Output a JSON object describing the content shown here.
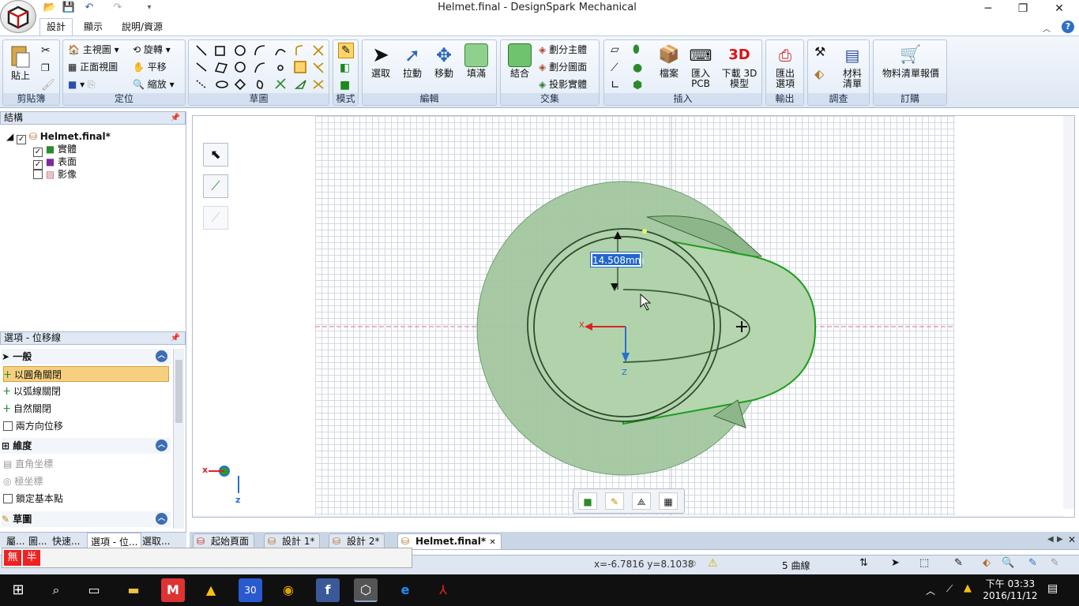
{
  "window": {
    "title": "Helmet.final - DesignSpark Mechanical",
    "minimize": "─",
    "maximize": "❐",
    "close": "✕"
  },
  "quick_access": {
    "open_icon": "folder-open",
    "save_icon": "save",
    "undo_icon": "undo",
    "redo_icon": "redo"
  },
  "ribbon_tabs": [
    "設計",
    "顯示",
    "說明/資源"
  ],
  "ribbon_tab_help": "?",
  "groups": {
    "clipboard": {
      "label": "剪貼簿",
      "paste": "貼上"
    },
    "orient": {
      "label": "定位",
      "home": "主視圖",
      "rotate": "旋轉",
      "front": "正面視圖",
      "pan": "平移",
      "zoom": "縮放"
    },
    "sketch": {
      "label": "草圖"
    },
    "mode": {
      "label": "模式"
    },
    "edit": {
      "label": "編輯",
      "select": "選取",
      "pull": "拉動",
      "move": "移動",
      "fill": "填滿"
    },
    "intersect": {
      "label": "交集",
      "combine": "結合",
      "split_body": "劃分主體",
      "split_face": "劃分圖面",
      "project": "投影實體"
    },
    "insert": {
      "label": "插入",
      "file": "檔案",
      "import_pcb": "匯入\nPCB",
      "download_3d": "下載 3D\n模型"
    },
    "output": {
      "label": "輸出",
      "export": "匯出\n選項"
    },
    "investigate": {
      "label": "調查",
      "bom": "材料\n清單"
    },
    "order": {
      "label": "訂購",
      "quote": "物料清單報價"
    }
  },
  "structure": {
    "title": "結構",
    "pin": "🖈",
    "root": "Helmet.final*",
    "items": [
      {
        "label": "實體",
        "checked": true
      },
      {
        "label": "表面",
        "checked": true
      },
      {
        "label": "影像",
        "checked": false
      }
    ]
  },
  "options": {
    "title": "選項 - 位移線",
    "sections": [
      {
        "title": "一般",
        "items": [
          {
            "label": "以圓角關閉",
            "selected": true,
            "check": false
          },
          {
            "label": "以弧線關閉",
            "selected": false,
            "check": false
          },
          {
            "label": "自然關閉",
            "selected": false,
            "check": false
          },
          {
            "label": "兩方向位移",
            "selected": false,
            "check": true
          }
        ]
      },
      {
        "title": "維度",
        "items": [
          {
            "label": "直角坐標",
            "disabled": true,
            "check": false
          },
          {
            "label": "極坐標",
            "disabled": true,
            "check": false
          },
          {
            "label": "鎖定基本點",
            "disabled": false,
            "check": true
          }
        ]
      },
      {
        "title": "草圖",
        "items": []
      }
    ]
  },
  "panel_tabs": [
    "屬...",
    "圖...",
    "快速...",
    "選項 - 位...",
    "選取..."
  ],
  "ime": {
    "a": "無",
    "b": "半"
  },
  "canvas": {
    "dimension": "14.508mm",
    "axis_x": "X",
    "axis_z": "Z",
    "mini_x": "x",
    "mini_z": "z"
  },
  "doc_tabs": [
    {
      "label": "起始頁面",
      "active": false
    },
    {
      "label": "設計 1*",
      "active": false
    },
    {
      "label": "設計 2*",
      "active": false
    },
    {
      "label": "Helmet.final*",
      "active": true
    }
  ],
  "doc_tab_close": "✕",
  "status": {
    "coords": "x=-6.7816  y=8.1038",
    "selection": "5 曲線"
  },
  "taskbar": {
    "time": "下午 03:33",
    "date": "2016/11/12",
    "calendar_day": "30"
  },
  "colors": {
    "accent": "#3d6db3",
    "model_fill": "#9cc79a",
    "curve": "#1c9e1c",
    "selected_option": "#f6d080"
  }
}
